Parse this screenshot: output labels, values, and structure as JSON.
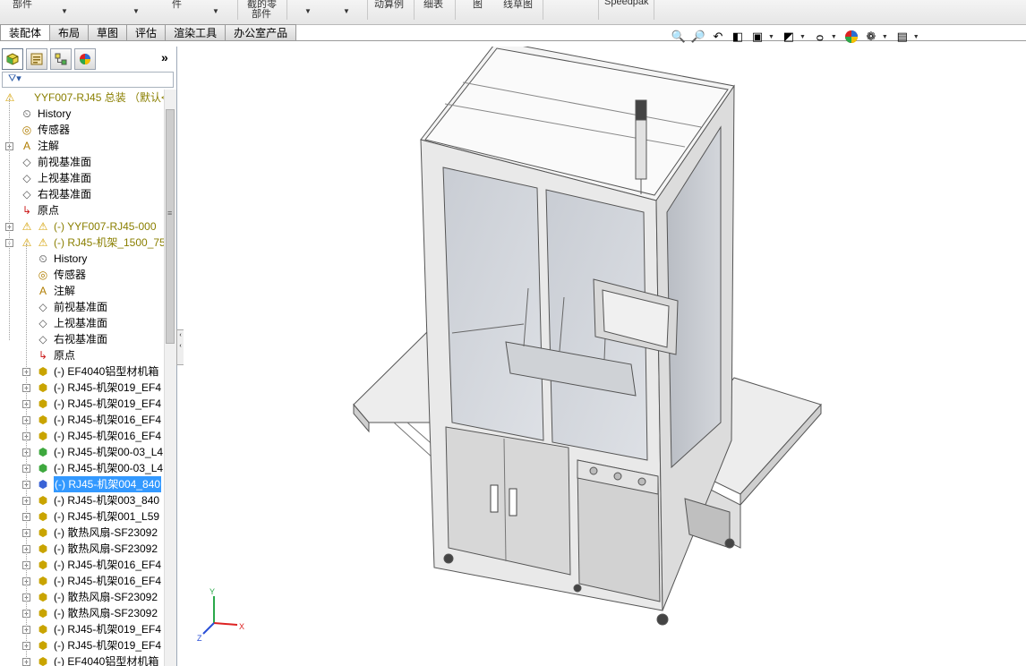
{
  "ribbon": {
    "commands": [
      "部件",
      "件",
      "截的零",
      "部件",
      "动算例",
      "细表",
      "图",
      "线草图",
      "Speedpak"
    ],
    "colors": {
      "background": "#f0f0f0"
    }
  },
  "tabs": [
    "装配体",
    "布局",
    "草图",
    "评估",
    "渲染工具",
    "办公室产品"
  ],
  "active_tab": "装配体",
  "manager_tabs": [
    {
      "icon": "feature-manager-icon"
    },
    {
      "icon": "property-manager-icon"
    },
    {
      "icon": "configuration-manager-icon"
    },
    {
      "icon": "display-manager-icon"
    }
  ],
  "expand_label": "»",
  "tree": {
    "root": "YYF007-RJ45 总装 （默认<",
    "items": [
      {
        "label": "History",
        "icon": "history-icon"
      },
      {
        "label": "传感器",
        "icon": "sensor-icon"
      },
      {
        "label": "注解",
        "icon": "annotation-icon"
      },
      {
        "label": "前视基准面",
        "icon": "plane-icon"
      },
      {
        "label": "上视基准面",
        "icon": "plane-icon"
      },
      {
        "label": "右视基准面",
        "icon": "plane-icon"
      },
      {
        "label": "原点",
        "icon": "origin-icon"
      },
      {
        "label": "(-) YYF007-RJ45-000",
        "icon": "subassembly-warning-icon"
      },
      {
        "label": "(-) RJ45-机架_1500_75",
        "icon": "subassembly-warning-icon"
      },
      {
        "label": "History",
        "icon": "history-icon"
      },
      {
        "label": "传感器",
        "icon": "sensor-icon"
      },
      {
        "label": "注解",
        "icon": "annotation-icon"
      },
      {
        "label": "前视基准面",
        "icon": "plane-icon"
      },
      {
        "label": "上视基准面",
        "icon": "plane-icon"
      },
      {
        "label": "右视基准面",
        "icon": "plane-icon"
      },
      {
        "label": "原点",
        "icon": "origin-icon"
      },
      {
        "label": "(-) EF4040铝型材机箱",
        "icon": "part-icon"
      },
      {
        "label": "(-) RJ45-机架019_EF4",
        "icon": "part-icon"
      },
      {
        "label": "(-) RJ45-机架019_EF4",
        "icon": "part-icon"
      },
      {
        "label": "(-) RJ45-机架016_EF4",
        "icon": "part-icon"
      },
      {
        "label": "(-) RJ45-机架016_EF4",
        "icon": "part-icon"
      },
      {
        "label": "(-) RJ45-机架00-03_L4",
        "icon": "assembly-icon"
      },
      {
        "label": "(-) RJ45-机架00-03_L4",
        "icon": "assembly-icon"
      },
      {
        "label": "(-) RJ45-机架004_840",
        "icon": "part-selected-icon"
      },
      {
        "label": "(-) RJ45-机架003_840",
        "icon": "part-icon"
      },
      {
        "label": "(-) RJ45-机架001_L59",
        "icon": "part-icon"
      },
      {
        "label": "(-) 散热风扇-SF23092",
        "icon": "part-icon"
      },
      {
        "label": "(-) 散热风扇-SF23092",
        "icon": "part-icon"
      },
      {
        "label": "(-) RJ45-机架016_EF4",
        "icon": "part-icon"
      },
      {
        "label": "(-) RJ45-机架016_EF4",
        "icon": "part-icon"
      },
      {
        "label": "(-) 散热风扇-SF23092",
        "icon": "part-icon"
      },
      {
        "label": "(-) 散热风扇-SF23092",
        "icon": "part-icon"
      },
      {
        "label": "(-) RJ45-机架019_EF4",
        "icon": "part-icon"
      },
      {
        "label": "(-) RJ45-机架019_EF4",
        "icon": "part-icon"
      },
      {
        "label": "(-) EF4040铝型材机箱",
        "icon": "part-icon"
      }
    ],
    "selected_label": "(-) RJ45-机架004_840"
  },
  "heads_up_toolbar": [
    "zoom-to-fit-icon",
    "zoom-to-area-icon",
    "previous-view-icon",
    "section-view-icon",
    "dynamic-annotation-icon",
    "view-orientation-icon",
    "display-style-icon",
    "hide-show-items-icon",
    "edit-appearance-icon",
    "apply-scene-icon",
    "view-settings-icon"
  ],
  "triad": {
    "x_label": "X",
    "y_label": "Y",
    "z_label": "Z"
  },
  "colors": {
    "selection": "#3399ff",
    "warning_text": "#8a7f00",
    "frame": "#555555"
  }
}
